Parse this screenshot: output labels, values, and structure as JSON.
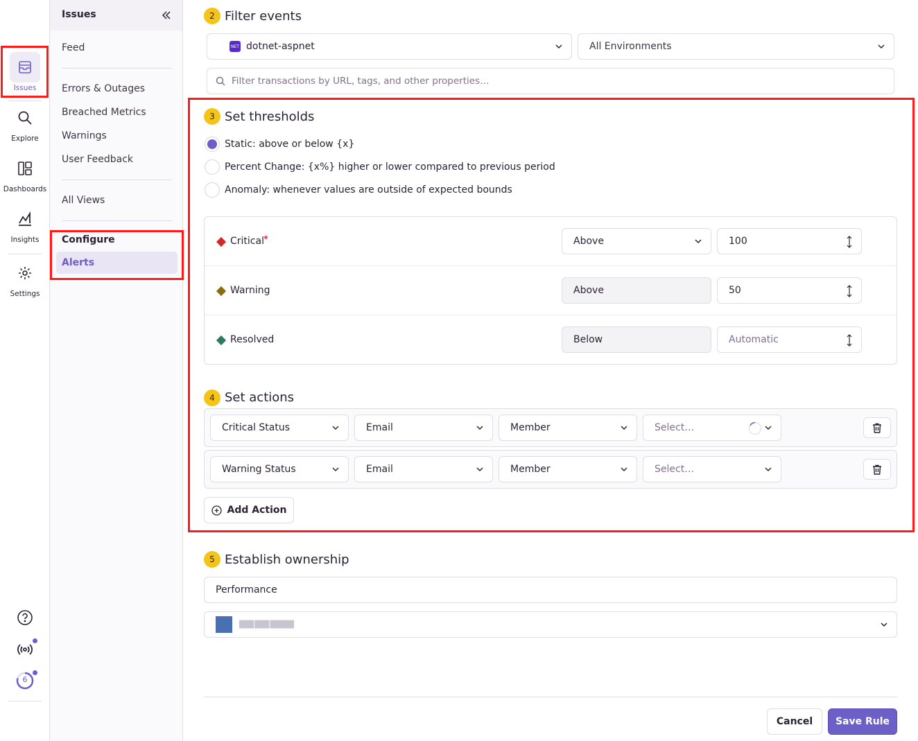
{
  "rail": {
    "items": [
      {
        "label": "Issues",
        "icon": "inbox-icon",
        "active": true
      },
      {
        "label": "Explore",
        "icon": "search-icon"
      },
      {
        "label": "Dashboards",
        "icon": "dashboard-icon"
      },
      {
        "label": "Insights",
        "icon": "insights-icon"
      },
      {
        "label": "Settings",
        "icon": "gear-icon"
      }
    ],
    "bottom": {
      "help_icon": "help-icon",
      "broadcast_icon": "broadcast-icon",
      "onboarding_count": "6"
    }
  },
  "subnav": {
    "title": "Issues",
    "items": [
      "Feed",
      "Errors & Outages",
      "Breached Metrics",
      "Warnings",
      "User Feedback",
      "All Views"
    ],
    "section": "Configure",
    "active": "Alerts"
  },
  "filter": {
    "step": "2",
    "title": "Filter events",
    "project": "dotnet-aspnet",
    "project_badge": "NET",
    "environment": "All Environments",
    "search_placeholder": "Filter transactions by URL, tags, and other properties…"
  },
  "thresholds": {
    "step": "3",
    "title": "Set thresholds",
    "options": [
      {
        "label": "Static: above or below {x}",
        "selected": true
      },
      {
        "label": "Percent Change: {x%} higher or lower compared to previous period",
        "selected": false
      },
      {
        "label": "Anomaly: whenever values are outside of expected bounds",
        "selected": false
      }
    ],
    "rows": [
      {
        "label": "Critical",
        "color": "#d12a2a",
        "direction": "Above",
        "value": "100",
        "required": true
      },
      {
        "label": "Warning",
        "color": "#8a6d0e",
        "direction": "Above",
        "value": "50"
      },
      {
        "label": "Resolved",
        "color": "#2c7a62",
        "direction": "Below",
        "value_placeholder": "Automatic"
      }
    ]
  },
  "actions": {
    "step": "4",
    "title": "Set actions",
    "rows": [
      {
        "trigger": "Critical Status",
        "type": "Email",
        "target_type": "Member",
        "target_placeholder": "Select…",
        "loading": true
      },
      {
        "trigger": "Warning Status",
        "type": "Email",
        "target_type": "Member",
        "target_placeholder": "Select…",
        "loading": false
      }
    ],
    "add_label": "Add Action"
  },
  "ownership": {
    "step": "5",
    "title": "Establish ownership",
    "rule_name": "Performance",
    "team_name_redacted": "███ ███ █████"
  },
  "footer": {
    "cancel": "Cancel",
    "save": "Save Rule"
  },
  "colors": {
    "accent": "#6c5fc7",
    "badge": "#f4c418",
    "highlight": "#ff1a1a"
  }
}
